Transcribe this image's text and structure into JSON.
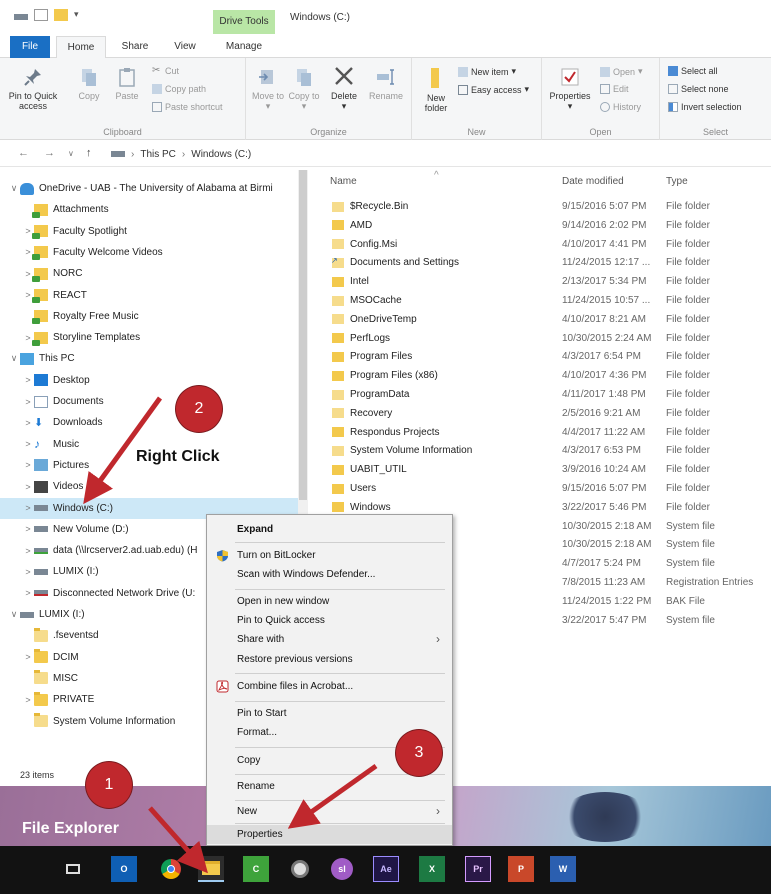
{
  "window": {
    "title": "Windows (C:)",
    "contextual_tab_group": "Drive Tools"
  },
  "tabs": [
    "File",
    "Home",
    "Share",
    "View",
    "Manage"
  ],
  "ribbon": {
    "clipboard": {
      "group_label": "Clipboard",
      "pin_to_quick_access": "Pin to Quick access",
      "copy": "Copy",
      "paste": "Paste",
      "cut": "Cut",
      "copy_path": "Copy path",
      "paste_shortcut": "Paste shortcut"
    },
    "organize": {
      "group_label": "Organize",
      "move_to": "Move to",
      "copy_to": "Copy to",
      "delete": "Delete",
      "rename": "Rename"
    },
    "new": {
      "group_label": "New",
      "new_folder": "New folder",
      "new_item": "New item",
      "easy_access": "Easy access"
    },
    "open": {
      "group_label": "Open",
      "properties": "Properties",
      "open": "Open",
      "edit": "Edit",
      "history": "History"
    },
    "select": {
      "group_label": "Select",
      "select_all": "Select all",
      "select_none": "Select none",
      "invert_selection": "Invert selection"
    }
  },
  "address": {
    "crumbs": [
      "This PC",
      "Windows (C:)"
    ]
  },
  "nav_pane": {
    "items": [
      {
        "label": "OneDrive - UAB - The University of Alabama at Birmi",
        "chev": "∨",
        "indent": 0
      },
      {
        "label": "Attachments",
        "chev": "",
        "indent": 1
      },
      {
        "label": "Faculty Spotlight",
        "chev": ">",
        "indent": 1
      },
      {
        "label": "Faculty Welcome Videos",
        "chev": ">",
        "indent": 1
      },
      {
        "label": "NORC",
        "chev": ">",
        "indent": 1
      },
      {
        "label": "REACT",
        "chev": ">",
        "indent": 1
      },
      {
        "label": "Royalty Free Music",
        "chev": "",
        "indent": 1
      },
      {
        "label": "Storyline Templates",
        "chev": ">",
        "indent": 1
      },
      {
        "label": "This PC",
        "chev": "∨",
        "indent": 0
      },
      {
        "label": "Desktop",
        "chev": ">",
        "indent": 1
      },
      {
        "label": "Documents",
        "chev": ">",
        "indent": 1
      },
      {
        "label": "Downloads",
        "chev": ">",
        "indent": 1
      },
      {
        "label": "Music",
        "chev": ">",
        "indent": 1
      },
      {
        "label": "Pictures",
        "chev": ">",
        "indent": 1
      },
      {
        "label": "Videos",
        "chev": ">",
        "indent": 1
      },
      {
        "label": "Windows (C:)",
        "chev": ">",
        "indent": 1
      },
      {
        "label": "New Volume (D:)",
        "chev": ">",
        "indent": 1
      },
      {
        "label": "data (\\\\lrcserver2.ad.uab.edu) (H",
        "chev": ">",
        "indent": 1
      },
      {
        "label": "LUMIX (I:)",
        "chev": ">",
        "indent": 1
      },
      {
        "label": "Disconnected Network Drive (U:",
        "chev": ">",
        "indent": 1
      },
      {
        "label": "LUMIX (I:)",
        "chev": "∨",
        "indent": 0
      },
      {
        "label": ".fseventsd",
        "chev": "",
        "indent": 1
      },
      {
        "label": "DCIM",
        "chev": ">",
        "indent": 1
      },
      {
        "label": "MISC",
        "chev": "",
        "indent": 1
      },
      {
        "label": "PRIVATE",
        "chev": ">",
        "indent": 1
      },
      {
        "label": "System Volume Information",
        "chev": "",
        "indent": 1
      }
    ]
  },
  "columns": {
    "name": "Name",
    "date": "Date modified",
    "type": "Type"
  },
  "files": [
    {
      "name": "$Recycle.Bin",
      "date": "9/15/2016 5:07 PM",
      "type": "File folder"
    },
    {
      "name": "AMD",
      "date": "9/14/2016 2:02 PM",
      "type": "File folder"
    },
    {
      "name": "Config.Msi",
      "date": "4/10/2017 4:41 PM",
      "type": "File folder"
    },
    {
      "name": "Documents and Settings",
      "date": "11/24/2015 12:17 ...",
      "type": "File folder"
    },
    {
      "name": "Intel",
      "date": "2/13/2017 5:34 PM",
      "type": "File folder"
    },
    {
      "name": "MSOCache",
      "date": "11/24/2015 10:57 ...",
      "type": "File folder"
    },
    {
      "name": "OneDriveTemp",
      "date": "4/10/2017 8:21 AM",
      "type": "File folder"
    },
    {
      "name": "PerfLogs",
      "date": "10/30/2015 2:24 AM",
      "type": "File folder"
    },
    {
      "name": "Program Files",
      "date": "4/3/2017 6:54 PM",
      "type": "File folder"
    },
    {
      "name": "Program Files (x86)",
      "date": "4/10/2017 4:36 PM",
      "type": "File folder"
    },
    {
      "name": "ProgramData",
      "date": "4/11/2017 1:48 PM",
      "type": "File folder"
    },
    {
      "name": "Recovery",
      "date": "2/5/2016 9:21 AM",
      "type": "File folder"
    },
    {
      "name": "Respondus Projects",
      "date": "4/4/2017 11:22 AM",
      "type": "File folder"
    },
    {
      "name": "System Volume Information",
      "date": "4/3/2017 6:53 PM",
      "type": "File folder"
    },
    {
      "name": "UABIT_UTIL",
      "date": "3/9/2016 10:24 AM",
      "type": "File folder"
    },
    {
      "name": "Users",
      "date": "9/15/2016 5:07 PM",
      "type": "File folder"
    },
    {
      "name": "Windows",
      "date": "3/22/2017 5:46 PM",
      "type": "File folder"
    },
    {
      "name": "",
      "date": "10/30/2015 2:18 AM",
      "type": "System file"
    },
    {
      "name": "",
      "date": "10/30/2015 2:18 AM",
      "type": "System file"
    },
    {
      "name": "",
      "date": "4/7/2017 5:24 PM",
      "type": "System file"
    },
    {
      "name": "",
      "date": "7/8/2015 11:23 AM",
      "type": "Registration Entries"
    },
    {
      "name": "",
      "date": "11/24/2015 1:22 PM",
      "type": "BAK File"
    },
    {
      "name": "",
      "date": "3/22/2017 5:47 PM",
      "type": "System file"
    }
  ],
  "status": {
    "items_count": "23 items"
  },
  "context_menu": {
    "expand": "Expand",
    "bitlocker": "Turn on BitLocker",
    "defender": "Scan with Windows Defender...",
    "open_new_window": "Open in new window",
    "pin_quick_access": "Pin to Quick access",
    "share_with": "Share with",
    "restore_versions": "Restore previous versions",
    "combine_acrobat": "Combine files in Acrobat...",
    "pin_start": "Pin to Start",
    "format": "Format...",
    "copy": "Copy",
    "rename": "Rename",
    "new": "New",
    "properties": "Properties"
  },
  "annotations": {
    "badge1": "1",
    "badge2": "2",
    "badge3": "3",
    "right_click": "Right Click",
    "file_explorer": "File Explorer"
  },
  "taskbar": {
    "icons": [
      "task-view-icon",
      "outlook-icon",
      "chrome-icon",
      "file-explorer-icon",
      "camtasia-icon",
      "snagit-icon",
      "storyline-icon",
      "after-effects-icon",
      "excel-icon",
      "premiere-icon",
      "powerpoint-icon",
      "word-icon"
    ],
    "labels": {
      "outlook": "O",
      "camtasia": "C",
      "storyline": "sl",
      "after_effects": "Ae",
      "excel": "X",
      "premiere": "Pr",
      "powerpoint": "P",
      "word": "W"
    }
  },
  "colors": {
    "accent_blue": "#1a6fc4",
    "drive_tools_green": "#b9e6a6",
    "annotation_red": "#c0282d",
    "selection": "#cde8f7"
  }
}
